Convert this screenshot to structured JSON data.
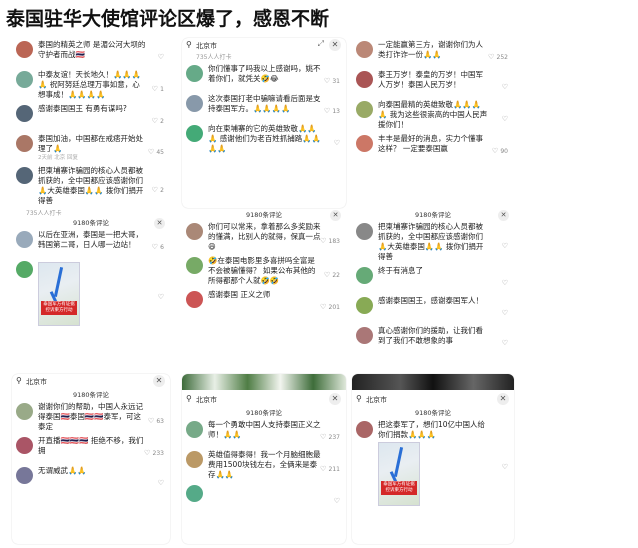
{
  "page_title": "泰国驻华大使馆评论区爆了，感恩不断",
  "panels": {
    "p1": {
      "comments": [
        {
          "user": "",
          "text": "泰国的精英之师 是湄公河大坝的守护者而战🇹🇭",
          "meta": "",
          "likes": "",
          "color": "#b65"
        },
        {
          "user": "",
          "text": "中泰友谊！天长地久！🙏🙏🙏🙏 祝阿努廷总理万事如意，心想事成！🙏🙏🙏🙏",
          "meta": "",
          "likes": "1",
          "color": "#7a9"
        },
        {
          "user": "",
          "text": "感谢泰国国王 有勇有谋吗?",
          "meta": "",
          "likes": "2",
          "color": "#567"
        },
        {
          "user": "",
          "text": "泰国加油，中国都在戒痞开始处理了🙏",
          "meta": "2天前 北京 回复",
          "likes": "45",
          "color": "#a76"
        },
        {
          "user": "",
          "text": "把柬埔寨诈骗园的核心人员都被抓获的，全中国都应该感谢你们 🙏大英雄泰国🙏🙏 拨你们捐开得善",
          "meta": "",
          "likes": "2",
          "color": "#567"
        }
      ]
    },
    "p2": {
      "location": "北京市",
      "subtitle": "735人人打卡",
      "comments": [
        {
          "user": "",
          "text": "你们懂事了吗我以上感谢吗，姚不着你们，就凭关🤣😂",
          "meta": "",
          "likes": "31",
          "color": "#6a8"
        },
        {
          "user": "",
          "text": "这次泰国打老中骗嘛请看后面是支持泰国军方。🙏🙏🙏🙏",
          "meta": "",
          "likes": "13",
          "color": "#89a"
        },
        {
          "user": "",
          "text": "向在柬埔寨的它的英雄致敬🙏🙏🙏 感谢他们为老百姓抓捕路🙏🙏🙏🙏",
          "meta": "",
          "likes": "",
          "color": "#4a7"
        }
      ]
    },
    "p3": {
      "comments": [
        {
          "user": "",
          "text": "一定能赢第三方，谢谢你们为人类打诈诈一份🙏🙏",
          "meta": "",
          "likes": "252",
          "color": "#b87"
        },
        {
          "user": "",
          "text": "泰王万岁！泰皇的万岁！中国军人万岁！泰国人民万岁！",
          "meta": "",
          "likes": "",
          "color": "#a55"
        },
        {
          "user": "",
          "text": "向泰国最精的英雄致敬🙏🙏🙏🙏 我为这些很崇高的中国人民声援你们！",
          "meta": "",
          "likes": "",
          "color": "#9a6"
        },
        {
          "user": "",
          "text": "丰丰是最好的消息，实力个懂事这样？ 一定要泰国赢",
          "meta": "",
          "likes": "90",
          "color": "#c76"
        }
      ]
    },
    "p4": {
      "count": "9180条评论",
      "subtitle": "735人人打卡",
      "comments": [
        {
          "user": "",
          "text": "以后在亚洲，泰国是一把大哥，韩国第二哥，日人哪一边站！",
          "meta": "",
          "likes": "6",
          "color": "#9ab"
        },
        {
          "user": "",
          "text": "",
          "meta": "",
          "likes": "",
          "color": "#5a6",
          "map": "泰国军方有证据控诉柬方行动"
        }
      ]
    },
    "p5": {
      "count": "9180条评论",
      "comments": [
        {
          "user": "",
          "text": "你们可以常来，拿着那么多奖励来的懂满，比别人的就得，保真一点😄",
          "meta": "",
          "likes": "183",
          "color": "#a87"
        },
        {
          "user": "",
          "text": "🤣在泰国电影里多喜拼吗全富是不会被骗懂得？ 如果公布其他的所得都那个人就🤣🤣",
          "meta": "",
          "likes": "22",
          "color": "#7a6"
        },
        {
          "user": "",
          "text": "感谢泰国 正义之师",
          "meta": "",
          "likes": "201",
          "color": "#c55"
        }
      ]
    },
    "p6": {
      "count": "9180条评论",
      "comments": [
        {
          "user": "",
          "text": "把柬埔寨诈骗园的核心人员都被抓获的，全中国都应该感谢你们 🙏大英雄泰国🙏🙏 拨你们捐开得善",
          "meta": "",
          "likes": "",
          "color": "#888"
        },
        {
          "user": "",
          "text": "终于有消息了",
          "meta": "",
          "likes": "",
          "color": "#6a7"
        },
        {
          "user": "",
          "text": "感谢泰国国王，感谢泰国军人！",
          "meta": "",
          "likes": "",
          "color": "#8a5"
        },
        {
          "user": "",
          "text": "真心感谢你们的援助，让我们看到了我们不敢想象的事",
          "meta": "",
          "likes": "",
          "color": "#a77"
        }
      ]
    },
    "p7": {
      "location": "北京市",
      "count": "9180条评论",
      "comments": [
        {
          "user": "",
          "text": "谢谢你们的帮助，中国人永远记得泰国🇹🇭泰国🇹🇭🇹🇭泰军，可这泰定",
          "meta": "",
          "likes": "63",
          "color": "#9a8"
        },
        {
          "user": "",
          "text": "开直播🇹🇭🇹🇭🇹🇭 拒绝不移，我们拥",
          "meta": "",
          "likes": "233",
          "color": "#a56"
        },
        {
          "user": "",
          "text": "无谓威武🙏🙏",
          "meta": "",
          "likes": "",
          "color": "#779"
        }
      ]
    },
    "p8": {
      "location": "北京市",
      "count": "9180条评论",
      "comments": [
        {
          "user": "",
          "text": "每一个勇敢中国人支持泰国正义之师！🙏🙏",
          "meta": "",
          "likes": "237",
          "color": "#7a8"
        },
        {
          "user": "",
          "text": "英雄值得泰得！我一个月脑细胞最费用1500块钱左右，全俩来是泰存🙏🙏",
          "meta": "",
          "likes": "211",
          "color": "#b96"
        },
        {
          "user": "",
          "text": "",
          "meta": "",
          "likes": "",
          "color": "#5a8"
        }
      ]
    },
    "p9": {
      "location": "北京市",
      "count": "9180条评论",
      "comments": [
        {
          "user": "",
          "text": "把这泰军了，想们10亿中国人给你们捐款🙏🙏🙏",
          "meta": "",
          "likes": "",
          "color": "#a66",
          "map": "泰国军方有证据控诉柬方行动"
        }
      ]
    }
  }
}
